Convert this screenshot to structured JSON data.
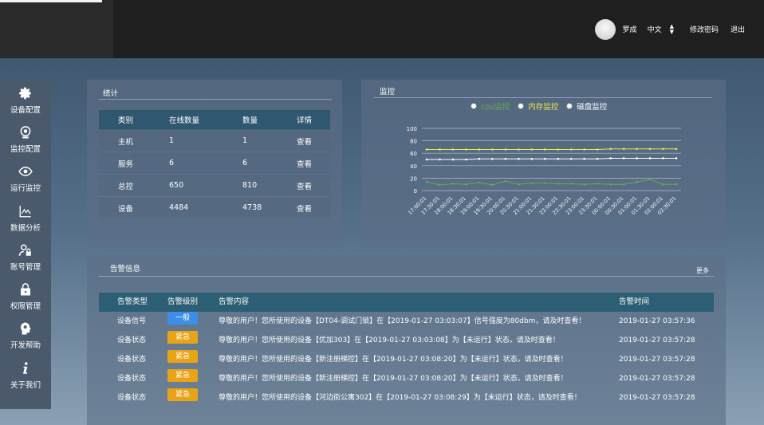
{
  "header": {
    "user_name": "罗成",
    "language": "中文",
    "change_password": "修改密码",
    "logout": "退出"
  },
  "sidebar": {
    "items": [
      {
        "label": "设备配置",
        "icon": "gear-icon"
      },
      {
        "label": "监控配置",
        "icon": "webcam-icon"
      },
      {
        "label": "运行监控",
        "icon": "eye-icon"
      },
      {
        "label": "数据分析",
        "icon": "line-chart-icon"
      },
      {
        "label": "账号管理",
        "icon": "user-lock-icon"
      },
      {
        "label": "权限管理",
        "icon": "lock-icon"
      },
      {
        "label": "开发帮助",
        "icon": "head-gear-icon"
      },
      {
        "label": "关于我们",
        "icon": "info-icon"
      }
    ]
  },
  "stats": {
    "title": "统计",
    "columns": [
      "类别",
      "在线数量",
      "数量",
      "详情"
    ],
    "rows": [
      {
        "category": "主机",
        "online": "1",
        "count": "1",
        "detail": "查看"
      },
      {
        "category": "服务",
        "online": "6",
        "count": "6",
        "detail": "查看"
      },
      {
        "category": "总控",
        "online": "650",
        "count": "810",
        "detail": "查看"
      },
      {
        "category": "设备",
        "online": "4484",
        "count": "4738",
        "detail": "查看"
      }
    ]
  },
  "monitor": {
    "title": "监控"
  },
  "chart_data": {
    "type": "line",
    "x": [
      "17:00:01",
      "17:30:01",
      "18:00:01",
      "18:30:01",
      "19:00:01",
      "19:30:01",
      "20:00:01",
      "20:30:01",
      "21:00:01",
      "21:30:01",
      "22:00:01",
      "22:30:01",
      "23:00:01",
      "23:30:01",
      "00:00:01",
      "00:30:01",
      "01:00:01",
      "01:30:01",
      "02:00:01",
      "02:30:01"
    ],
    "series": [
      {
        "name": "cpu监控",
        "color": "#6aa84f",
        "values": [
          14,
          9,
          11,
          10,
          13,
          9,
          15,
          10,
          12,
          12,
          11,
          11,
          10,
          11,
          10,
          10,
          14,
          18,
          10,
          10
        ]
      },
      {
        "name": "内存监控",
        "color": "#e8e84a",
        "values": [
          66,
          66,
          66,
          66,
          66,
          66,
          66,
          66,
          66,
          66,
          66,
          66,
          66,
          66,
          67,
          67,
          67,
          67,
          67,
          67
        ]
      },
      {
        "name": "磁盘监控",
        "color": "#ffffff",
        "values": [
          50,
          50,
          50,
          50,
          51,
          51,
          51,
          51,
          51,
          51,
          51,
          51,
          51,
          51,
          52,
          52,
          52,
          52,
          52,
          52
        ]
      }
    ],
    "yticks": [
      0,
      20,
      40,
      60,
      80,
      100
    ],
    "ylim": [
      0,
      100
    ],
    "grid": true,
    "legend": "top"
  },
  "alarms": {
    "title": "告警信息",
    "more": "更多",
    "columns": [
      "告警类型",
      "告警级别",
      "告警内容",
      "告警时间"
    ],
    "rows": [
      {
        "type": "设备信号",
        "level": "一般",
        "level_color": "#3d8ee6",
        "content": "尊敬的用户！您所使用的设备【DT04-调试门锁】在【2019-01-27 03:03:07】信号强度为80dbm，请及时查看！",
        "time": "2019-01-27 03:57:36"
      },
      {
        "type": "设备状态",
        "level": "紧急",
        "level_color": "#e8a317",
        "content": "尊敬的用户！您所使用的设备【优加303】在【2019-01-27 03:03:08】为【未运行】状态，请及时查看！",
        "time": "2019-01-27 03:57:28"
      },
      {
        "type": "设备状态",
        "level": "紧急",
        "level_color": "#e8a317",
        "content": "尊敬的用户！您所使用的设备【新注册梯控】在【2019-01-27 03:08:20】为【未运行】状态，请及时查看！",
        "time": "2019-01-27 03:57:28"
      },
      {
        "type": "设备状态",
        "level": "紧急",
        "level_color": "#e8a317",
        "content": "尊敬的用户！您所使用的设备【新注册梯控】在【2019-01-27 03:08:20】为【未运行】状态，请及时查看！",
        "time": "2019-01-27 03:57:28"
      },
      {
        "type": "设备状态",
        "level": "紧急",
        "level_color": "#e8a317",
        "content": "尊敬的用户！您所使用的设备【河边街公寓302】在【2019-01-27 03:08:29】为【未运行】状态，请及时查看！",
        "time": "2019-01-27 03:57:28"
      }
    ]
  }
}
